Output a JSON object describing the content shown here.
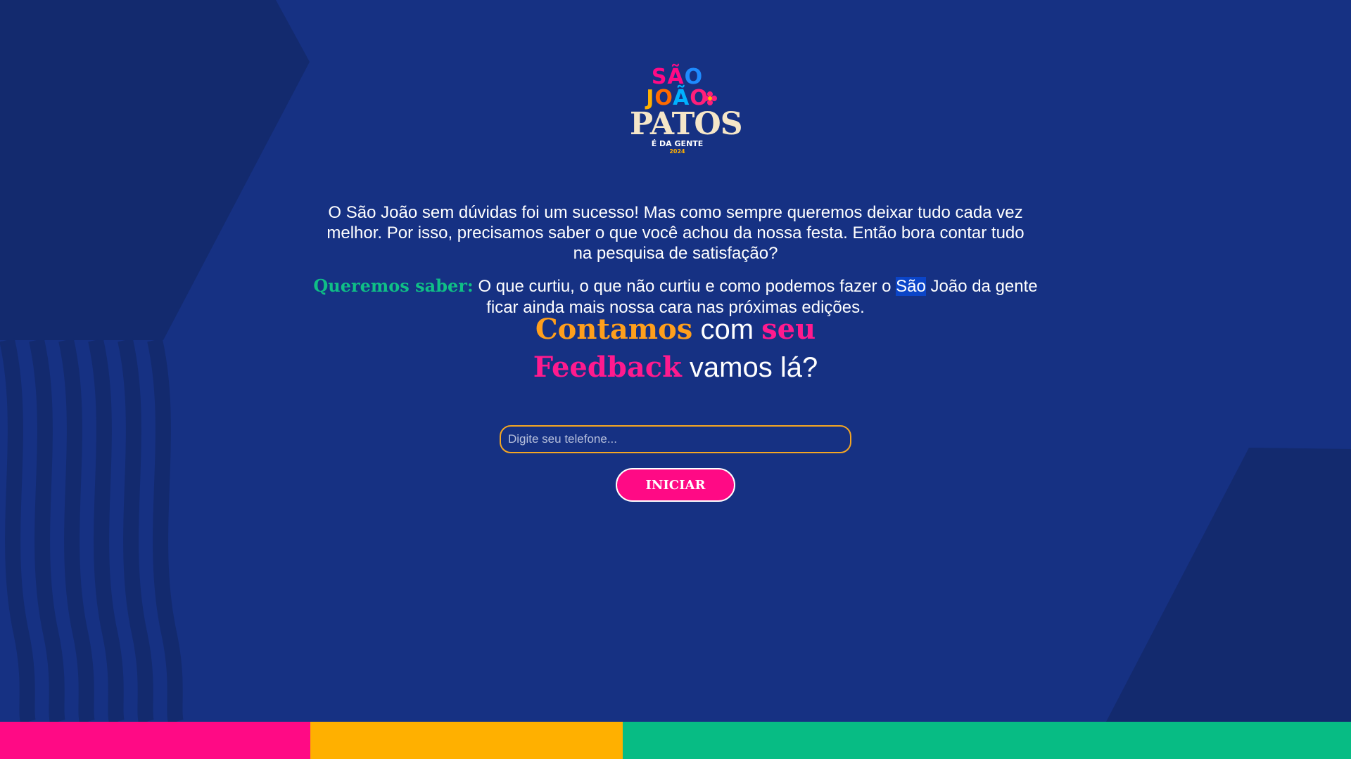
{
  "logo": {
    "line1_a": "SÃ",
    "line1_b": "O",
    "line2_j": "J",
    "line2_o1": "O",
    "line2_a": "Ã",
    "line2_o2": "O",
    "line3": "PATOS",
    "tagline": "É DA GENTE",
    "year": "2024"
  },
  "intro": {
    "text": "O São João sem dúvidas foi um sucesso! Mas como sempre queremos deixar tudo cada vez melhor. Por isso, precisamos saber o que você achou da nossa festa. Então bora contar tudo na pesquisa de satisfação?"
  },
  "want_to_know": {
    "lead": "Queremos saber:",
    "text_before": " O que curtiu, o que não curtiu e como podemos fazer o ",
    "highlight": "São",
    "text_after": " João da gente ficar ainda mais nossa cara nas próximas edições."
  },
  "cta": {
    "word1": "Contamos",
    "word2": " com ",
    "word3": "seu",
    "word4": "Feedback",
    "word5": " vamos lá?"
  },
  "form": {
    "phone_placeholder": "Digite seu telefone...",
    "phone_value": "",
    "start_label": "INICIAR"
  },
  "colors": {
    "background": "#163183",
    "shape_dark": "#132a6e",
    "pink": "#ff0a85",
    "yellow": "#ffb000",
    "green": "#07bc84",
    "orange": "#ff9f1c",
    "teal_text": "#0fbf86"
  },
  "icons": {
    "logo_flower": "flower-icon"
  }
}
